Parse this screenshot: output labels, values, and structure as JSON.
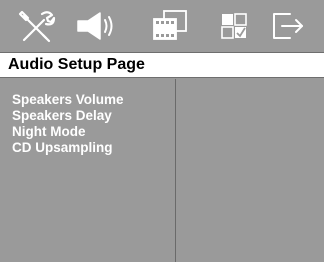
{
  "tabs": [
    {
      "icon": "wrench-screwdriver-icon",
      "name": "tab-general-setup"
    },
    {
      "icon": "speaker-icon",
      "name": "tab-audio-setup"
    },
    {
      "icon": "film-frames-icon",
      "name": "tab-video-setup"
    },
    {
      "icon": "preference-grid-icon",
      "name": "tab-preference-setup"
    },
    {
      "icon": "exit-arrow-icon",
      "name": "tab-exit"
    }
  ],
  "page": {
    "title": "Audio Setup Page"
  },
  "menu": {
    "items": [
      {
        "label": "Speakers Volume"
      },
      {
        "label": "Speakers Delay"
      },
      {
        "label": "Night Mode"
      },
      {
        "label": "CD Upsampling"
      }
    ]
  },
  "colors": {
    "background": "#9a9a9a",
    "title_bar": "#ffffff",
    "menu_text": "#ffffff",
    "title_text": "#000000"
  }
}
